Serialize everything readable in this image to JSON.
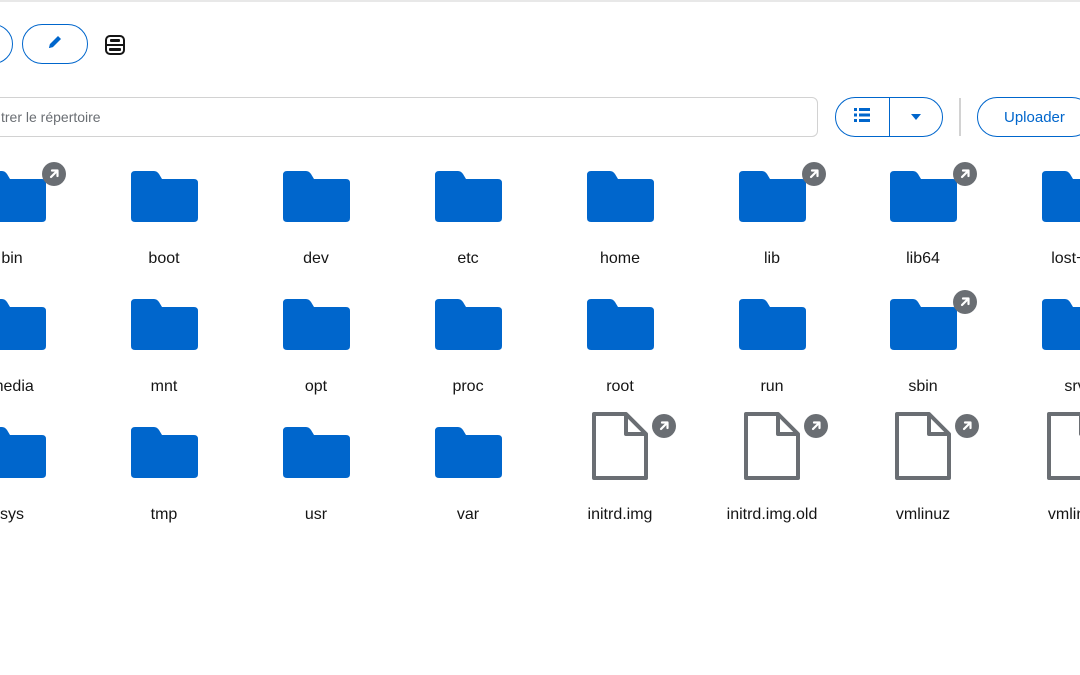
{
  "toolbar": {
    "edit_icon": "pencil-icon",
    "drive_icon": "drive-icon"
  },
  "filter": {
    "placeholder": "trer le répertoire"
  },
  "view": {
    "list_icon": "list-view-icon",
    "dropdown_icon": "caret-down-icon"
  },
  "upload": {
    "label": "Uploader"
  },
  "colors": {
    "accent": "#0066cc",
    "folder": "#0066cc",
    "file_stroke": "#6a6e73",
    "badge": "#6a6e73"
  },
  "files": [
    {
      "name": "bin",
      "type": "folder",
      "symlink": true
    },
    {
      "name": "boot",
      "type": "folder",
      "symlink": false
    },
    {
      "name": "dev",
      "type": "folder",
      "symlink": false
    },
    {
      "name": "etc",
      "type": "folder",
      "symlink": false
    },
    {
      "name": "home",
      "type": "folder",
      "symlink": false
    },
    {
      "name": "lib",
      "type": "folder",
      "symlink": true
    },
    {
      "name": "lib64",
      "type": "folder",
      "symlink": true
    },
    {
      "name": "lost+fo",
      "type": "folder",
      "symlink": false
    },
    {
      "name": "media",
      "type": "folder",
      "symlink": false
    },
    {
      "name": "mnt",
      "type": "folder",
      "symlink": false
    },
    {
      "name": "opt",
      "type": "folder",
      "symlink": false
    },
    {
      "name": "proc",
      "type": "folder",
      "symlink": false
    },
    {
      "name": "root",
      "type": "folder",
      "symlink": false
    },
    {
      "name": "run",
      "type": "folder",
      "symlink": false
    },
    {
      "name": "sbin",
      "type": "folder",
      "symlink": true
    },
    {
      "name": "srv",
      "type": "folder",
      "symlink": false
    },
    {
      "name": "sys",
      "type": "folder",
      "symlink": false
    },
    {
      "name": "tmp",
      "type": "folder",
      "symlink": false
    },
    {
      "name": "usr",
      "type": "folder",
      "symlink": false
    },
    {
      "name": "var",
      "type": "folder",
      "symlink": false
    },
    {
      "name": "initrd.img",
      "type": "file",
      "symlink": true
    },
    {
      "name": "initrd.img.old",
      "type": "file",
      "symlink": true
    },
    {
      "name": "vmlinuz",
      "type": "file",
      "symlink": true
    },
    {
      "name": "vmlinuz",
      "type": "file",
      "symlink": false
    }
  ]
}
